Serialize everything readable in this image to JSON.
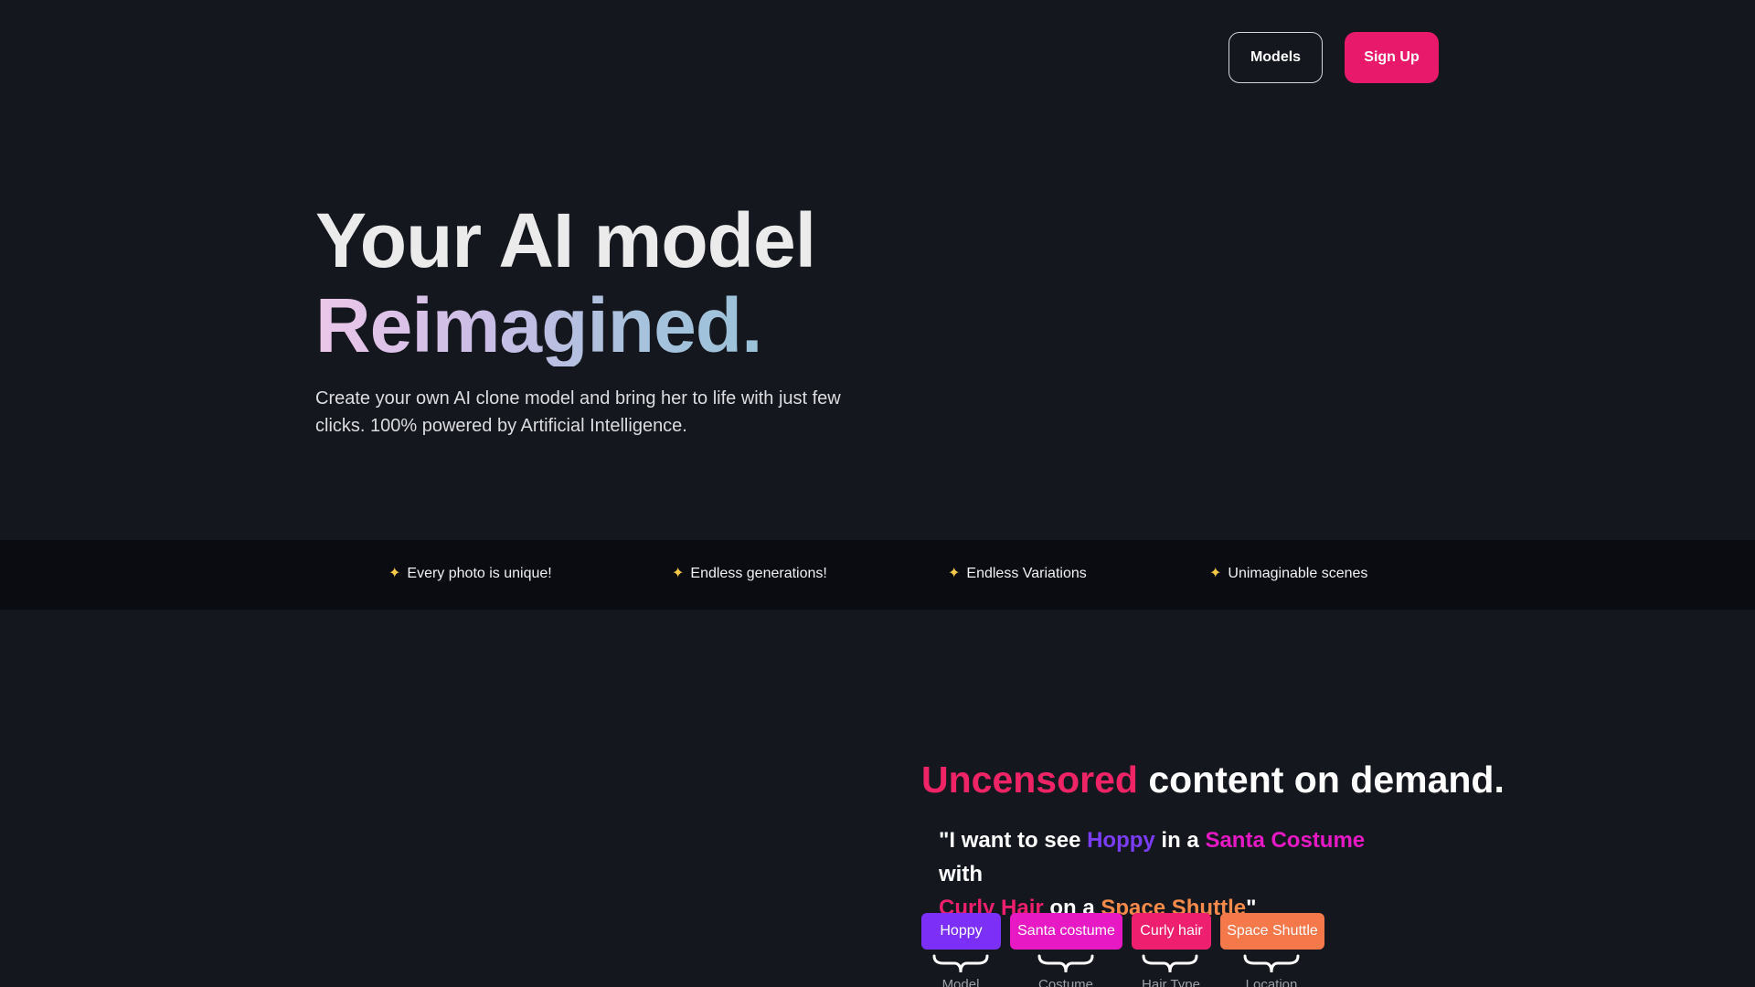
{
  "nav": {
    "models_label": "Models",
    "signup_label": "Sign Up"
  },
  "hero": {
    "title_line1": "Your AI model",
    "title_line2": "Reimagined.",
    "description": "Create your own AI clone model and bring her to life with just few clicks. 100% powered by Artificial Intelligence."
  },
  "features": [
    {
      "icon": "sparkle-icon",
      "label": "Every photo is unique!"
    },
    {
      "icon": "sparkle-icon",
      "label": "Endless generations!"
    },
    {
      "icon": "sparkle-icon",
      "label": "Endless Variations"
    },
    {
      "icon": "sparkle-icon",
      "label": "Unimaginable scenes"
    }
  ],
  "uncensored": {
    "title_accent": "Uncensored",
    "title_rest": "content on demand.",
    "quote": {
      "p1": "\"I want to see ",
      "model": "Hoppy",
      "p2": " in a ",
      "costume": "Santa Costume",
      "p3": " with ",
      "hair": "Curly Hair",
      "p4": " on a ",
      "location": "Space Shuttle",
      "p5": "\""
    },
    "tags": [
      {
        "label": "Hoppy",
        "category": "Model",
        "color": "#7b2ff7"
      },
      {
        "label": "Santa costume",
        "category": "Costume",
        "color": "#e619c5"
      },
      {
        "label": "Curly hair",
        "category": "Hair Type",
        "color": "#ee1f6f"
      },
      {
        "label": "Space Shuttle",
        "category": "Location",
        "color": "#f4784a"
      }
    ]
  },
  "colors": {
    "background": "#15171e",
    "band": "#0a0c12",
    "accent_pink": "#e8196a",
    "sparkle": "#f7c948"
  }
}
